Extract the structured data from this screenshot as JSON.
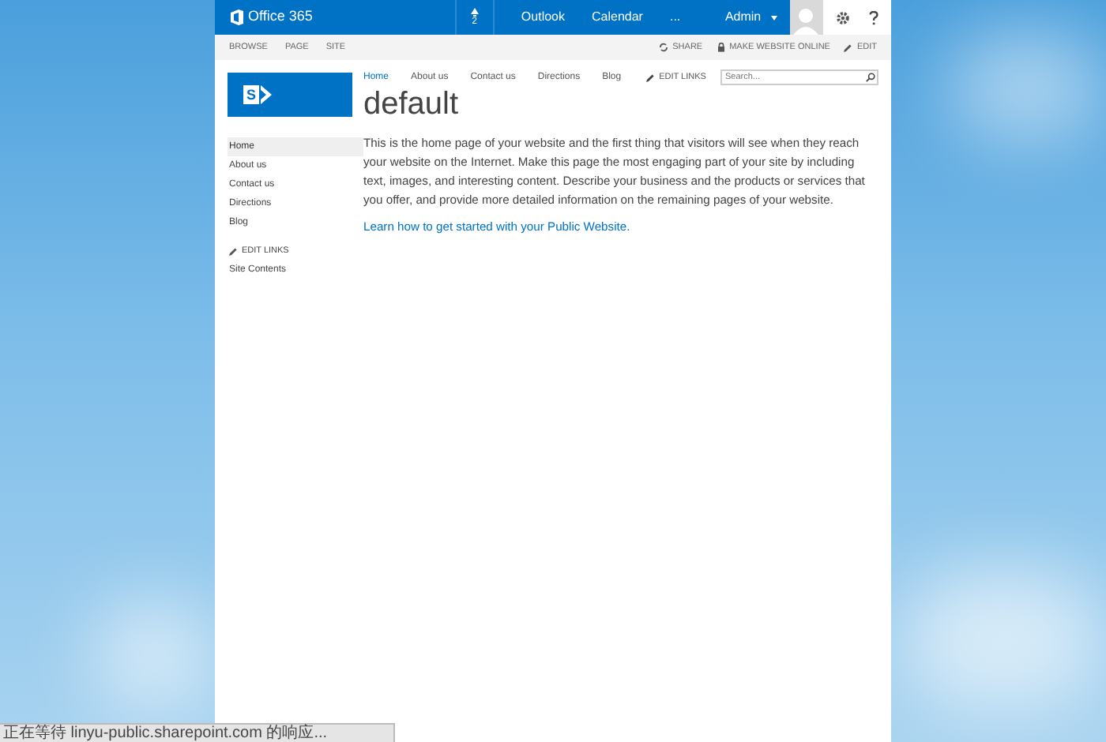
{
  "suite_bar": {
    "brand": "Office 365",
    "notification_count": "2",
    "links": [
      "Outlook",
      "Calendar",
      "..."
    ],
    "user": "Admin"
  },
  "ribbon": {
    "tabs": [
      "BROWSE",
      "PAGE",
      "SITE"
    ],
    "actions": [
      {
        "kind": "share",
        "label": "SHARE"
      },
      {
        "kind": "lock",
        "label": "MAKE WEBSITE ONLINE"
      },
      {
        "kind": "edit",
        "label": "EDIT"
      }
    ]
  },
  "top_nav": {
    "items": [
      {
        "label": "Home",
        "selected": true
      },
      {
        "label": "About us",
        "selected": false
      },
      {
        "label": "Contact us",
        "selected": false
      },
      {
        "label": "Directions",
        "selected": false
      },
      {
        "label": "Blog",
        "selected": false
      }
    ],
    "edit_links": "EDIT LINKS"
  },
  "search": {
    "placeholder": "Search..."
  },
  "site_logo_letter": "S",
  "page_title": "default",
  "body": "This is the home page of your website and the first thing that visitors will see when they reach your website on the Internet. Make this page the most engaging part of your site by including text, images, and interesting content. Describe your business and the products or services that you offer, and provide more detailed information on the remaining pages of your website.",
  "link": "Learn how to get started with your Public Website.",
  "left_nav": {
    "items": [
      {
        "label": "Home",
        "selected": true
      },
      {
        "label": "About us",
        "selected": false
      },
      {
        "label": "Contact us",
        "selected": false
      },
      {
        "label": "Directions",
        "selected": false
      },
      {
        "label": "Blog",
        "selected": false
      }
    ],
    "edit_links": "EDIT LINKS",
    "site_contents": "Site Contents"
  },
  "status_bar": "正在等待 linyu-public.sharepoint.com 的响应..."
}
